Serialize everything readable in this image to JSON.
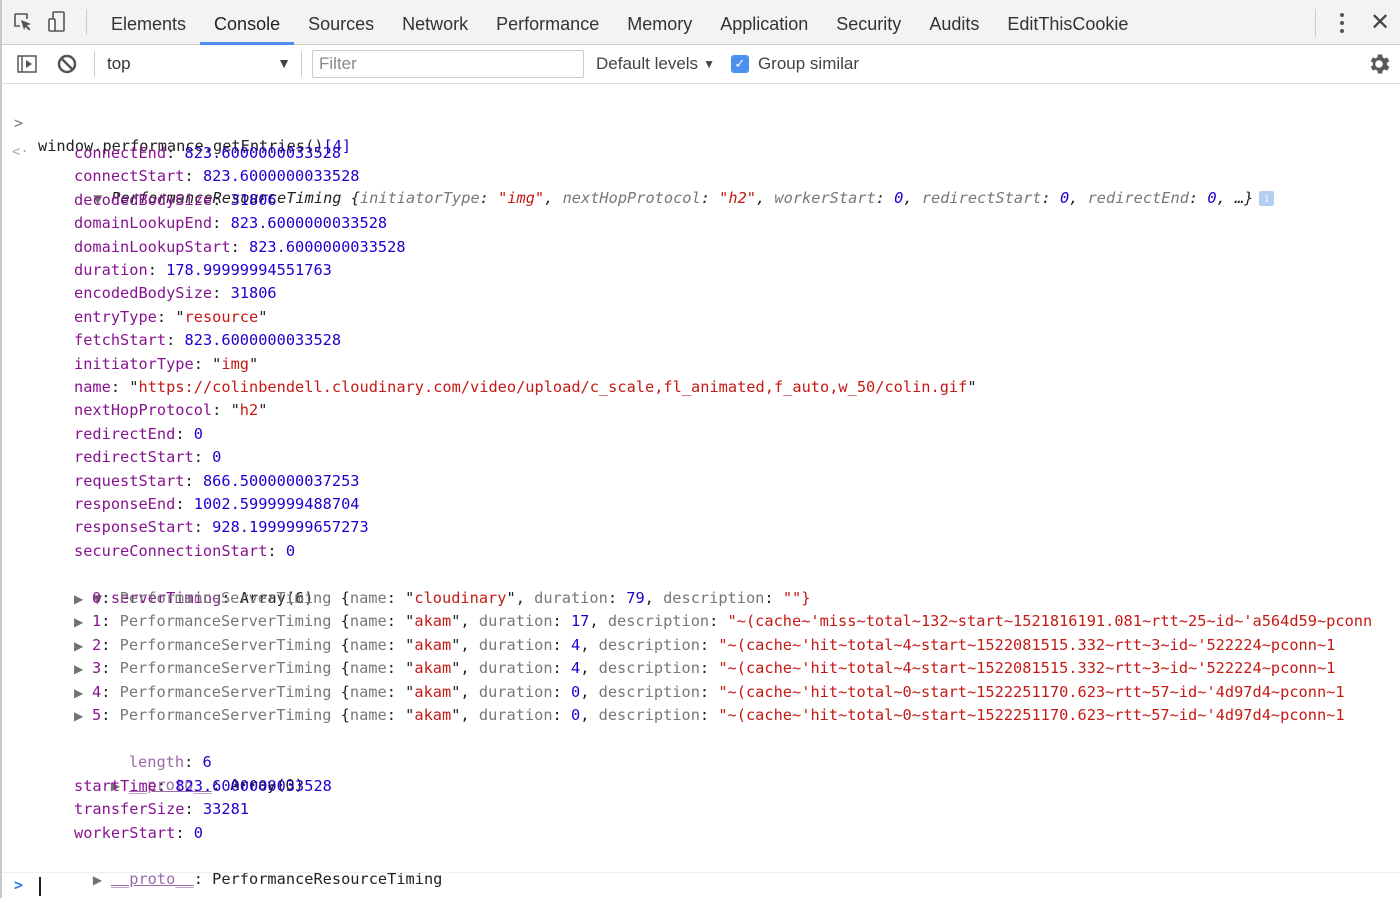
{
  "tabbar": {
    "tabs": [
      {
        "label": "Elements",
        "active": false
      },
      {
        "label": "Console",
        "active": true
      },
      {
        "label": "Sources",
        "active": false
      },
      {
        "label": "Network",
        "active": false
      },
      {
        "label": "Performance",
        "active": false
      },
      {
        "label": "Memory",
        "active": false
      },
      {
        "label": "Application",
        "active": false
      },
      {
        "label": "Security",
        "active": false
      },
      {
        "label": "Audits",
        "active": false
      },
      {
        "label": "EditThisCookie",
        "active": false
      }
    ],
    "icons": {
      "inspect": "inspect-element-icon",
      "device": "device-toolbar-icon",
      "more": "kebab-menu-icon",
      "close": "close-icon"
    },
    "accent": "#4d8ef0"
  },
  "toolbar": {
    "context": "top",
    "filter_placeholder": "Filter",
    "filter_value": "",
    "levels": "Default levels",
    "group_similar_label": "Group similar",
    "group_similar_checked": true
  },
  "console": {
    "command": "window.performance.getEntries()",
    "command_index": "[4]",
    "result": {
      "class_name": "PerformanceResourceTiming",
      "preview": [
        {
          "key": "initiatorType",
          "value": "\"img\"",
          "type": "str"
        },
        {
          "key": "nextHopProtocol",
          "value": "\"h2\"",
          "type": "str"
        },
        {
          "key": "workerStart",
          "value": "0",
          "type": "num"
        },
        {
          "key": "redirectStart",
          "value": "0",
          "type": "num"
        },
        {
          "key": "redirectEnd",
          "value": "0",
          "type": "num"
        }
      ],
      "preview_ellipsis": "…}",
      "info_badge": "i",
      "properties": [
        {
          "key": "connectEnd",
          "value": "823.6000000033528",
          "type": "num"
        },
        {
          "key": "connectStart",
          "value": "823.6000000033528",
          "type": "num"
        },
        {
          "key": "decodedBodySize",
          "value": "31806",
          "type": "num"
        },
        {
          "key": "domainLookupEnd",
          "value": "823.6000000033528",
          "type": "num"
        },
        {
          "key": "domainLookupStart",
          "value": "823.6000000033528",
          "type": "num"
        },
        {
          "key": "duration",
          "value": "178.99999994551763",
          "type": "num"
        },
        {
          "key": "encodedBodySize",
          "value": "31806",
          "type": "num"
        },
        {
          "key": "entryType",
          "value": "resource",
          "type": "str"
        },
        {
          "key": "fetchStart",
          "value": "823.6000000033528",
          "type": "num"
        },
        {
          "key": "initiatorType",
          "value": "img",
          "type": "str"
        },
        {
          "key": "name",
          "value": "https://colinbendell.cloudinary.com/video/upload/c_scale,fl_animated,f_auto,w_50/colin.gif",
          "type": "str"
        },
        {
          "key": "nextHopProtocol",
          "value": "h2",
          "type": "str"
        },
        {
          "key": "redirectEnd",
          "value": "0",
          "type": "num"
        },
        {
          "key": "redirectStart",
          "value": "0",
          "type": "num"
        },
        {
          "key": "requestStart",
          "value": "866.5000000037253",
          "type": "num"
        },
        {
          "key": "responseEnd",
          "value": "1002.5999999488704",
          "type": "num"
        },
        {
          "key": "responseStart",
          "value": "928.1999999657273",
          "type": "num"
        },
        {
          "key": "secureConnectionStart",
          "value": "0",
          "type": "num"
        }
      ],
      "server_timing": {
        "key": "serverTiming",
        "summary": "Array(6)",
        "items": [
          {
            "index": "0",
            "class_name": "PerformanceServerTiming",
            "name": "cloudinary",
            "duration": "79",
            "description": "\"\"}"
          },
          {
            "index": "1",
            "class_name": "PerformanceServerTiming",
            "name": "akam",
            "duration": "17",
            "description": "\"~(cache~'miss~total~132~start~1521816191.081~rtt~25~id~'a564d59~pconn"
          },
          {
            "index": "2",
            "class_name": "PerformanceServerTiming",
            "name": "akam",
            "duration": "4",
            "description": "\"~(cache~'hit~total~4~start~1522081515.332~rtt~3~id~'522224~pconn~1"
          },
          {
            "index": "3",
            "class_name": "PerformanceServerTiming",
            "name": "akam",
            "duration": "4",
            "description": "\"~(cache~'hit~total~4~start~1522081515.332~rtt~3~id~'522224~pconn~1"
          },
          {
            "index": "4",
            "class_name": "PerformanceServerTiming",
            "name": "akam",
            "duration": "0",
            "description": "\"~(cache~'hit~total~0~start~1522251170.623~rtt~57~id~'4d97d4~pconn~1"
          },
          {
            "index": "5",
            "class_name": "PerformanceServerTiming",
            "name": "akam",
            "duration": "0",
            "description": "\"~(cache~'hit~total~0~start~1522251170.623~rtt~57~id~'4d97d4~pconn~1"
          }
        ],
        "length_key": "length",
        "length": "6",
        "proto_key": "__proto__",
        "proto_value": "Array(0)"
      },
      "tail_properties": [
        {
          "key": "startTime",
          "value": "823.6000000033528",
          "type": "num"
        },
        {
          "key": "transferSize",
          "value": "33281",
          "type": "num"
        },
        {
          "key": "workerStart",
          "value": "0",
          "type": "num"
        }
      ],
      "proto_key": "__proto__",
      "proto_value": "PerformanceResourceTiming"
    },
    "input_value": ""
  },
  "colors": {
    "key": "#881391",
    "number": "#1c00cf",
    "string": "#c41a16",
    "checkbox": "#4c90f0"
  }
}
